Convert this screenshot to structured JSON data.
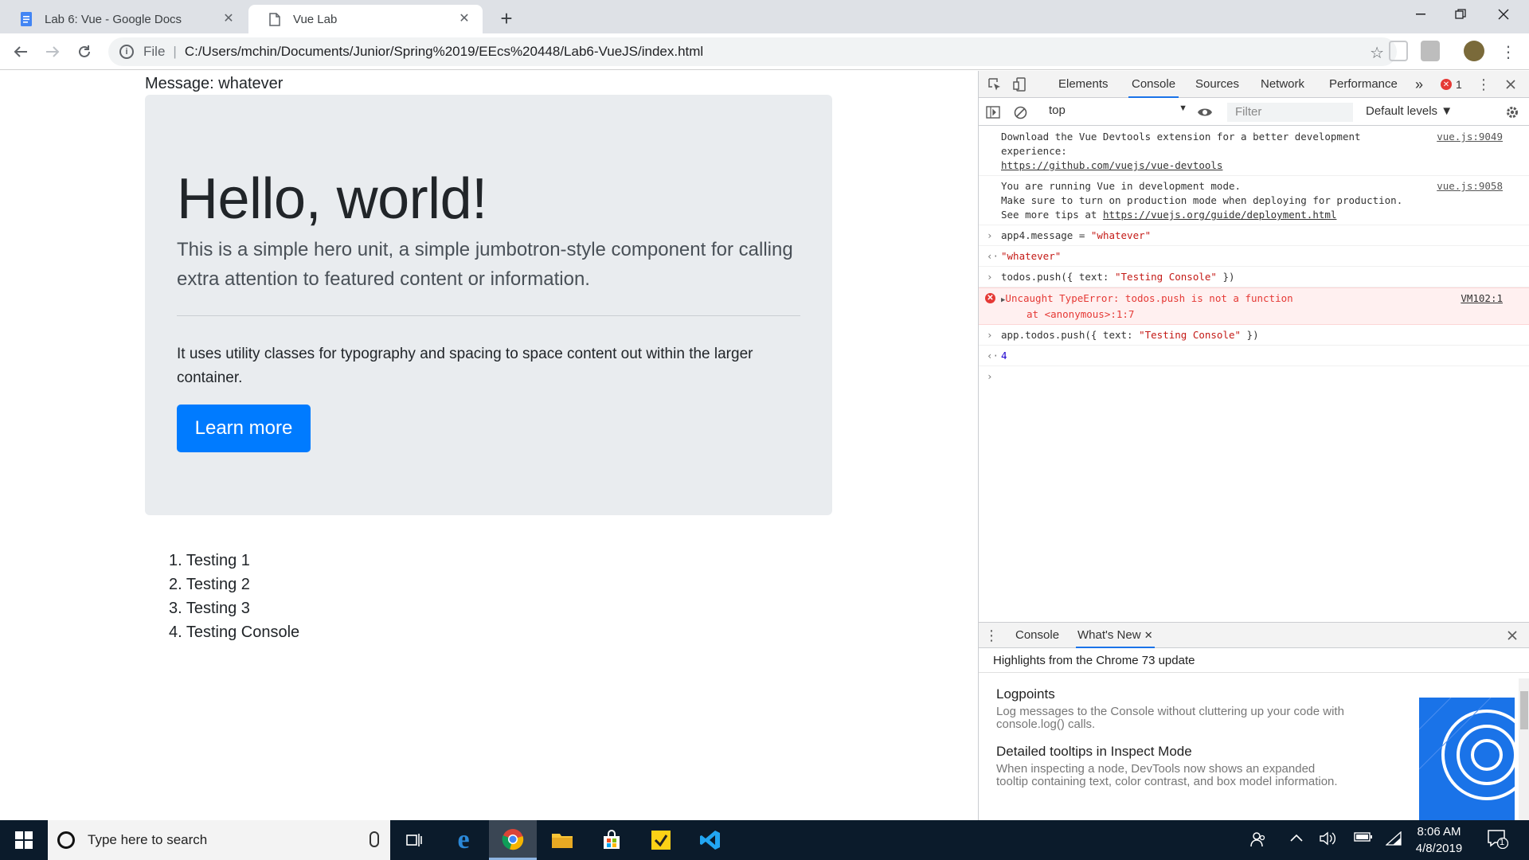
{
  "browser": {
    "tabs": [
      {
        "title": "Lab 6: Vue - Google Docs",
        "icon": "google-docs-icon",
        "active": false
      },
      {
        "title": "Vue Lab",
        "icon": "page-icon",
        "active": true
      }
    ],
    "address": {
      "scheme_label": "File",
      "separator": "|",
      "url": "C:/Users/mchin/Documents/Junior/Spring%2019/EEcs%20448/Lab6-VueJS/index.html"
    }
  },
  "page": {
    "message_line": "Message: whatever",
    "jumbotron": {
      "heading": "Hello, world!",
      "lead": "This is a simple hero unit, a simple jumbotron-style component for calling extra attention to featured content or information.",
      "body": "It uses utility classes for typography and spacing to space content out within the larger container.",
      "button": "Learn more"
    },
    "todos": [
      "1. Testing 1",
      "2. Testing 2",
      "3. Testing 3",
      "4. Testing Console"
    ]
  },
  "devtools": {
    "tabs": [
      "Elements",
      "Console",
      "Sources",
      "Network",
      "Performance"
    ],
    "active_tab": "Console",
    "more_tabs": "»",
    "error_count": "1",
    "context": "top",
    "filter_placeholder": "Filter",
    "levels": "Default levels ▼",
    "console": {
      "msg1": {
        "line1": "Download the Vue Devtools extension for a better development",
        "line2": "experience:",
        "link": "https://github.com/vuejs/vue-devtools",
        "source": "vue.js:9049"
      },
      "msg2": {
        "line1": "You are running Vue in development mode.",
        "line2": "Make sure to turn on production mode when deploying for production.",
        "line3_prefix": "See more tips at ",
        "link": "https://vuejs.org/guide/deployment.html",
        "source": "vue.js:9058"
      },
      "in1": {
        "code": "app4.message",
        "op": " = ",
        "value": "\"whatever\""
      },
      "out1": "\"whatever\"",
      "in2": {
        "code": "todos.push({ text: ",
        "value": "\"Testing Console\"",
        "tail": " })"
      },
      "error": {
        "line1": "Uncaught TypeError: todos.push is not a function",
        "line2": "at <anonymous>:1:7",
        "source": "VM102:1"
      },
      "in3": {
        "code": "app.todos.push({ text: ",
        "value": "\"Testing Console\"",
        "tail": " })"
      },
      "out3": "4"
    },
    "drawer": {
      "tabs": [
        "Console",
        "What's New"
      ],
      "active_tab": "What's New",
      "heading": "Highlights from the Chrome 73 update",
      "features": [
        {
          "title": "Logpoints",
          "desc": "Log messages to the Console without cluttering up your code with console.log() calls."
        },
        {
          "title": "Detailed tooltips in Inspect Mode",
          "desc": "When inspecting a node, DevTools now shows an expanded tooltip containing text, color contrast, and box model information."
        }
      ]
    }
  },
  "taskbar": {
    "search_placeholder": "Type here to search",
    "time": "8:06 AM",
    "date": "4/8/2019",
    "notification_count": "1",
    "pinned": [
      "task-view-icon",
      "edge-icon",
      "chrome-icon",
      "file-explorer-icon",
      "store-icon",
      "sticky-notes-icon",
      "vscode-icon"
    ],
    "colors": {
      "bar": "#0b1b2b",
      "accent": "#1a73e8",
      "primary_button": "#007bff"
    }
  }
}
